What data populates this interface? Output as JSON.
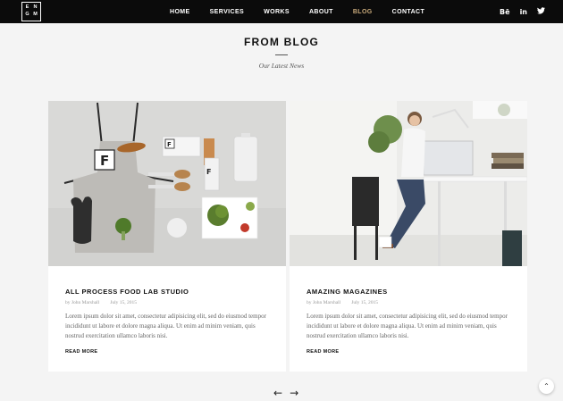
{
  "logo": {
    "letters": [
      "E",
      "N",
      "G",
      "M"
    ]
  },
  "nav": {
    "items": [
      {
        "label": "HOME",
        "active": false
      },
      {
        "label": "SERVICES",
        "active": false
      },
      {
        "label": "WORKS",
        "active": false
      },
      {
        "label": "ABOUT",
        "active": false
      },
      {
        "label": "BLOG",
        "active": true
      },
      {
        "label": "CONTACT",
        "active": false
      }
    ],
    "social": [
      {
        "label": "Bē",
        "icon": "behance-icon"
      },
      {
        "label": "in",
        "icon": "linkedin-icon"
      },
      {
        "label": "🐦",
        "icon": "twitter-icon"
      }
    ]
  },
  "section": {
    "title": "FROM BLOG",
    "subtitle": "Our Latest News"
  },
  "posts": [
    {
      "title": "ALL PROCESS FOOD LAB STUDIO",
      "author": "by John Marshall",
      "date": "July 15, 2015",
      "excerpt": "Lorem ipsum dolor sit amet, consectetur adipisicing elit, sed do eiusmod tempor incididunt ut labore et dolore magna aliqua. Ut enim ad minim veniam, quis nostrud exercitation ullamco laboris nisi.",
      "read_more": "READ MORE"
    },
    {
      "title": "AMAZING MAGAZINES",
      "author": "by John Marshall",
      "date": "July 15, 2015",
      "excerpt": "Lorem ipsum dolor sit amet, consectetur adipisicing elit, sed do eiusmod tempor incididunt ut labore et dolore magna aliqua. Ut enim ad minim veniam, quis nostrud exercitation ullamco laboris nisi.",
      "read_more": "READ MORE"
    }
  ],
  "pager": {
    "prev": "←",
    "next": "→"
  },
  "back_to_top": "⌃",
  "colors": {
    "nav_bg": "#0b0b0b",
    "accent": "#c8a97a",
    "page_bg": "#f4f4f4"
  }
}
